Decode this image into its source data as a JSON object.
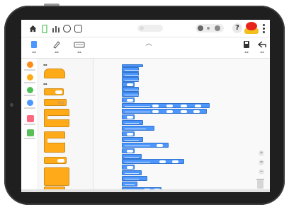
{
  "colors": {
    "bezel": "#1f1f1f",
    "blocks_blue": "#4c97ff",
    "blocks_orange": "#ffab19",
    "alarm_red": "#e8231a"
  },
  "topbar": {
    "icons": [
      "home-icon",
      "phone-icon",
      "chart-icon",
      "download-icon",
      "settings-icon"
    ],
    "help_label": "?"
  },
  "toolbar": {
    "tools": [
      "file-icon",
      "edit-icon",
      "keyboard-icon"
    ],
    "right_tools": [
      "save-icon",
      "back-icon"
    ]
  },
  "categories": [
    {
      "name": "cat-motion",
      "color": "#ff8c1a"
    },
    {
      "name": "cat-control",
      "color": "#ffab19"
    },
    {
      "name": "cat-sensing",
      "color": "#4cbf56"
    },
    {
      "name": "cat-operators",
      "color": "#4c97ff"
    },
    {
      "name": "cat-variables",
      "color": "#ff6680"
    },
    {
      "name": "cat-myblocks",
      "color": "#59c059"
    }
  ]
}
